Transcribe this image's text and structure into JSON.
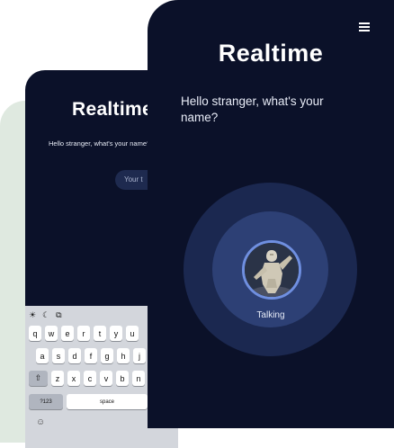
{
  "back_screen": {
    "title": "Realtime",
    "prompt": "Hello stranger, what's your name?",
    "input_placeholder": "Your t",
    "keyboard": {
      "toolbar": [
        "☀",
        "☾",
        "⧉"
      ],
      "row1": [
        "q",
        "w",
        "e",
        "r",
        "t",
        "y",
        "u"
      ],
      "row2": [
        "a",
        "s",
        "d",
        "f",
        "g",
        "h",
        "j"
      ],
      "row3": [
        "z",
        "x",
        "c",
        "v",
        "b",
        "n"
      ],
      "shift": "⇧",
      "numbers_key": "?123",
      "space_key": "space",
      "emoji": "☺"
    }
  },
  "front_screen": {
    "title": "Realtime",
    "prompt": "Hello stranger, what's your name?",
    "status": "Talking",
    "menu_icon": "hamburger-menu-icon",
    "colors": {
      "background": "#0b1129",
      "ring_outer": "#1b2850",
      "ring_inner": "#2d4075",
      "avatar_border": "#6f8fe0"
    }
  }
}
